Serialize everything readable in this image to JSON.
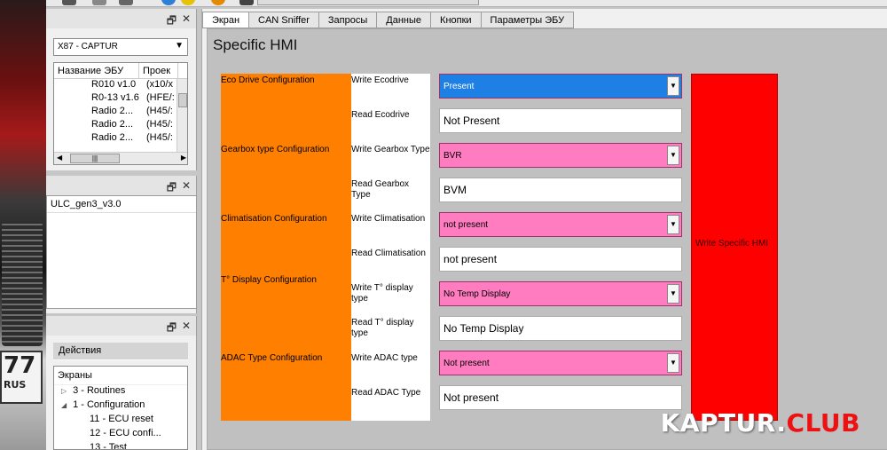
{
  "vehicle": {
    "selected": "X87 - CAPTUR"
  },
  "ecu_table": {
    "columns": [
      "Название ЭБУ",
      "Проек"
    ],
    "rows": [
      {
        "name": "R010 v1.0",
        "proj": "(x10/x"
      },
      {
        "name": "R0-13 v1.6",
        "proj": "(HFE/:"
      },
      {
        "name": "Radio 2...",
        "proj": "(H45/:"
      },
      {
        "name": "Radio 2...",
        "proj": "(H45/:"
      },
      {
        "name": "Radio 2...",
        "proj": "(H45/:"
      }
    ]
  },
  "panel_ctrl": {
    "float": "🗗",
    "close": "✕"
  },
  "session": {
    "item": "ULC_gen3_v3.0"
  },
  "actions": {
    "header": "Действия",
    "screens_title": "Экраны",
    "tree": [
      {
        "label": "3 - Routines",
        "toggle": "▷",
        "indent": 0
      },
      {
        "label": "1 - Configuration",
        "toggle": "◢",
        "indent": 0
      },
      {
        "label": "11 - ECU reset",
        "toggle": "",
        "indent": 1
      },
      {
        "label": "12 - ECU confi...",
        "toggle": "",
        "indent": 1
      },
      {
        "label": "13 - Test",
        "toggle": "",
        "indent": 1
      }
    ]
  },
  "tabs": [
    "Экран",
    "CAN Sniffer",
    "Запросы",
    "Данные",
    "Кнопки",
    "Параметры ЭБУ"
  ],
  "screen": {
    "title": "Specific HMI",
    "configs": [
      "Eco Drive Configuration",
      "Gearbox type Configuration",
      "Climatisation Configuration",
      "T° Display Configuration",
      "ADAC Type Configuration"
    ],
    "labels": {
      "write_eco": "Write Ecodrive",
      "read_eco": "Read Ecodrive",
      "write_gearbox": "Write Gearbox Type",
      "read_gearbox": "Read Gearbox Type",
      "write_clim": "Write Climatisation",
      "read_clim": "Read Climatisation",
      "write_temp": "Write T° display type",
      "read_temp": "Read T° display type",
      "write_adac": "Write ADAC type",
      "read_adac": "Read ADAC Type"
    },
    "values": {
      "write_eco": "Present",
      "read_eco": "Not Present",
      "write_gearbox": "BVR",
      "read_gearbox": "BVM",
      "write_clim": "not present",
      "read_clim": "not present",
      "write_temp": "No Temp Display",
      "read_temp": "No Temp Display",
      "write_adac": "Not present",
      "read_adac": "Not present"
    },
    "write_button": "Write Specific HMI"
  },
  "watermark": {
    "part1": "KAPTUR.",
    "part2": "CLUB"
  },
  "colors": {
    "orange": "#ff7f00",
    "pink": "#ff7cc0",
    "red": "#ff0000",
    "selected_blue": "#1e7fe5"
  }
}
